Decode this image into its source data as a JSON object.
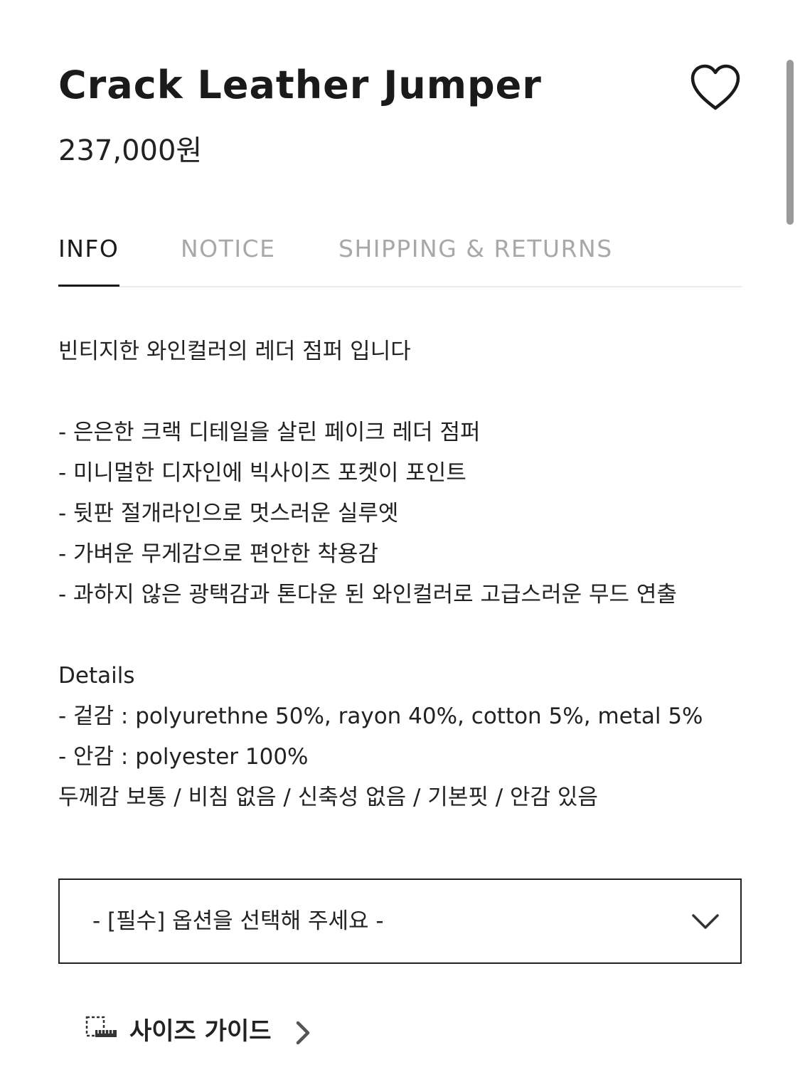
{
  "product": {
    "title": "Crack Leather Jumper",
    "price": "237,000원"
  },
  "tabs": [
    {
      "label": "INFO",
      "active": true
    },
    {
      "label": "NOTICE",
      "active": false
    },
    {
      "label": "SHIPPING & RETURNS",
      "active": false
    }
  ],
  "info": {
    "intro": "빈티지한 와인컬러의 레더 점퍼 입니다",
    "bullets": [
      "- 은은한 크랙 디테일을 살린 페이크 레더 점퍼",
      "- 미니멀한 디자인에 빅사이즈 포켓이 포인트",
      "- 뒷판 절개라인으로 멋스러운 실루엣",
      "- 가벼운 무게감으로 편안한 착용감",
      "- 과하지 않은 광택감과 톤다운 된 와인컬러로 고급스러운 무드 연출"
    ],
    "details_heading": "Details",
    "details": [
      "- 겉감 : polyurethne 50%, rayon 40%, cotton 5%, metal 5%",
      "- 안감 : polyester 100%",
      "두께감 보통 / 비침 없음 / 신축성 없음 / 기본핏 / 안감 있음"
    ]
  },
  "option_select": {
    "placeholder": "- [필수] 옵션을 선택해 주세요 -"
  },
  "size_guide": {
    "label": "사이즈 가이드"
  },
  "icons": {
    "wishlist": "heart-outline-icon",
    "dropdown": "chevron-down-icon",
    "size_guide": "ruler-icon",
    "size_guide_arrow": "chevron-right-icon"
  },
  "colors": {
    "text": "#222222",
    "tab_inactive": "#a8a8a8",
    "divider": "#ececec"
  }
}
